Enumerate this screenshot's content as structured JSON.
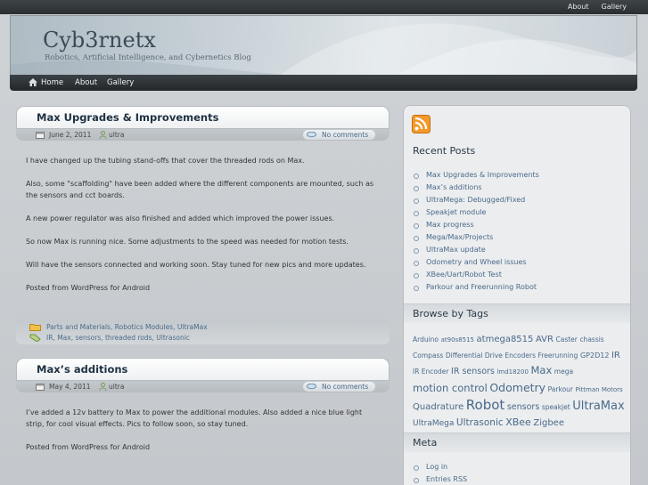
{
  "site": {
    "title": "Cyb3rnetx",
    "tagline": "Robotics, Artificial Intelligence, and Cybernetics Blog"
  },
  "top_links": [
    "About",
    "Gallery"
  ],
  "nav": [
    "Home",
    "About",
    "Gallery"
  ],
  "posts": [
    {
      "title": "Max Upgrades & Improvements",
      "date": "June 2, 2011",
      "author": "ultra",
      "comments": "No comments",
      "paragraphs": [
        "I have changed up the tubing stand-offs that cover the threaded rods on Max.",
        "Also, some \"scaffolding\" have been added where the different components are mounted, such as the sensors and cct boards.",
        "A new power regulator was also finished and added which improved the power issues.",
        "So now Max is running nice. Some adjustments to the speed was needed for motion tests.",
        "Will have the sensors connected and working soon. Stay tuned for new pics and more updates.",
        "Posted from WordPress for Android"
      ],
      "categories": "Parts and Materials, Robotics Modules, UltraMax",
      "tags": "IR, Max, sensors, threaded rods, Ultrasonic"
    },
    {
      "title": "Max’s additions",
      "date": "May 4, 2011",
      "author": "ultra",
      "comments": "No comments",
      "paragraphs": [
        "I’ve added a 12v battery to Max to power the additional modules. Also added a nice blue light strip, for cool visual effects. Pics to follow soon, so stay tuned.",
        "Posted from WordPress for Android"
      ]
    }
  ],
  "sidebar": {
    "recent_heading": "Recent Posts",
    "recent_posts": [
      "Max Upgrades & Improvements",
      "Max’s additions",
      "UltraMega: Debugged/Fixed",
      "Speakjet module",
      "Max progress",
      "Mega/Max/Projects",
      "UltraMax update",
      "Odometry and Wheel issues",
      "XBee/Uart/Robot Test",
      "Parkour and Freerunning Robot"
    ],
    "tags_heading": "Browse by Tags",
    "tags": [
      {
        "text": "Arduino",
        "size": 7.5
      },
      {
        "text": "at90s8515",
        "size": 7
      },
      {
        "text": "atmega8515",
        "size": 10
      },
      {
        "text": "AVR",
        "size": 10
      },
      {
        "text": "Caster",
        "size": 7.5
      },
      {
        "text": "chassis",
        "size": 7.5
      },
      {
        "text": "Compass",
        "size": 7.5
      },
      {
        "text": "Differential Drive",
        "size": 7.5
      },
      {
        "text": "Encoders",
        "size": 7.5
      },
      {
        "text": "Freerunning",
        "size": 7.5
      },
      {
        "text": "GP2D12",
        "size": 8
      },
      {
        "text": "IR",
        "size": 10
      },
      {
        "text": "IR Encoder",
        "size": 7.5
      },
      {
        "text": "IR sensors",
        "size": 9.5
      },
      {
        "text": "lmd18200",
        "size": 7
      },
      {
        "text": "Max",
        "size": 11.5
      },
      {
        "text": "mega",
        "size": 7.5
      },
      {
        "text": "motion control",
        "size": 11.5
      },
      {
        "text": "Odometry",
        "size": 12.5
      },
      {
        "text": "Parkour",
        "size": 7.5
      },
      {
        "text": "Pittman Motors",
        "size": 7
      },
      {
        "text": "Quadrature",
        "size": 10
      },
      {
        "text": "Robot",
        "size": 15
      },
      {
        "text": "sensors",
        "size": 9.5
      },
      {
        "text": "speakjet",
        "size": 7.5
      },
      {
        "text": "UltraMax",
        "size": 13
      },
      {
        "text": "UltraMega",
        "size": 9
      },
      {
        "text": "Ultrasonic",
        "size": 10.5
      },
      {
        "text": "XBee",
        "size": 11
      },
      {
        "text": "Zigbee",
        "size": 10
      }
    ],
    "meta_heading": "Meta",
    "meta_links": [
      "Log in",
      "Entries RSS"
    ]
  },
  "colors": {
    "link": "#4a6a8a",
    "title": "#1f3243",
    "topbar": "#2b2f32"
  }
}
